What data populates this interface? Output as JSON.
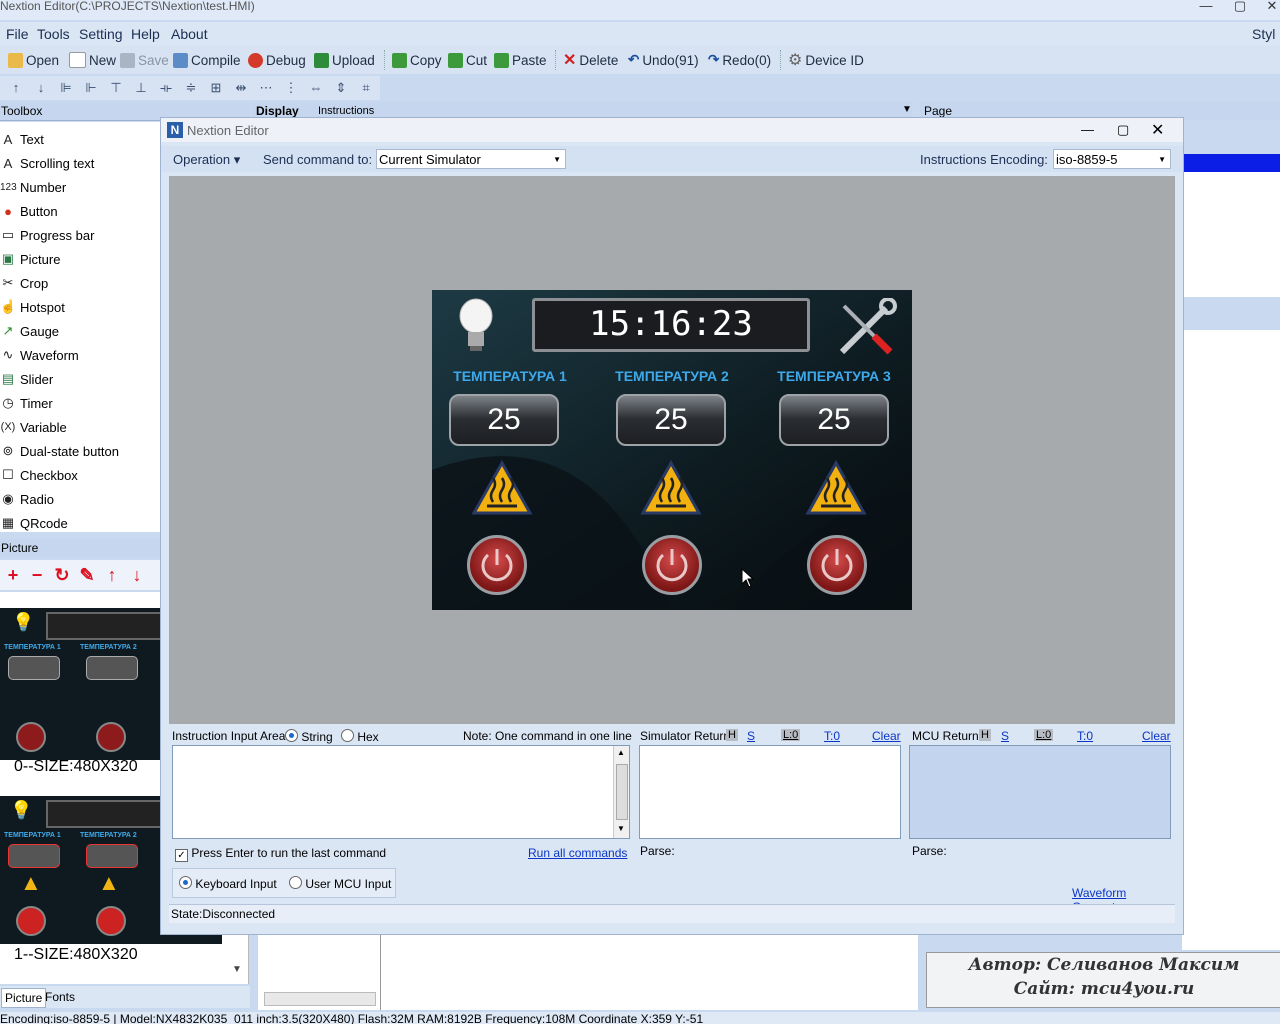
{
  "window": {
    "title": "Nextion Editor(C:\\PROJECTS\\Nextion\\test.HMI)",
    "corner_text": "Styl"
  },
  "menu": [
    "File",
    "Tools",
    "Setting",
    "Help",
    "About"
  ],
  "toolbar": {
    "open": "Open",
    "new": "New",
    "save": "Save",
    "compile": "Compile",
    "debug": "Debug",
    "upload": "Upload",
    "copy": "Copy",
    "cut": "Cut",
    "paste": "Paste",
    "delete": "Delete",
    "undo": "Undo(91)",
    "redo": "Redo(0)",
    "device": "Device  ID"
  },
  "toolbox": {
    "title": "Toolbox",
    "items": [
      "Text",
      "Scrolling text",
      "Number",
      "Button",
      "Progress bar",
      "Picture",
      "Crop",
      "Hotspot",
      "Gauge",
      "Waveform",
      "Slider",
      "Timer",
      "Variable",
      "Dual-state button",
      "Checkbox",
      "Radio",
      "QRcode"
    ],
    "glyphs": [
      "A",
      "A",
      "123",
      "●",
      "▭",
      "▣",
      "✂",
      "☝",
      "↗",
      "∿",
      "▤",
      "◷",
      "(X)",
      "⊚",
      "☐",
      "◉",
      "▦"
    ]
  },
  "picture_panel": {
    "title": "Picture",
    "thumb1_label": "0--SIZE:480X320",
    "thumb2_label": "1--SIZE:480X320",
    "thumb_temps": [
      "ТЕМПЕРАТУРА 1",
      "ТЕМПЕРАТУРА 2"
    ]
  },
  "bottom_tabs": [
    "Picture",
    "Fonts"
  ],
  "background": {
    "display_tab": "Display",
    "instructions_tab": "Instructions",
    "page_header": "Page"
  },
  "credit": {
    "line1": "Автор: Селиванов Максим",
    "line2": "Сайт: mcu4you.ru"
  },
  "status_bar": "Encoding:iso-8859-5 | Model:NX4832K035_011  inch:3.5(320X480) Flash:32M RAM:8192B Frequency:108M     Coordinate X:359  Y:-51",
  "dialog": {
    "title": "Nextion Editor",
    "operation": "Operation",
    "send_label": "Send command to:",
    "send_target": "Current Simulator",
    "encoding_label": "Instructions Encoding:",
    "encoding_value": "iso-8859-5",
    "screen": {
      "time": "15:16:23",
      "temps": [
        {
          "label": "ТЕМПЕРАТУРА 1",
          "value": "25"
        },
        {
          "label": "ТЕМПЕРАТУРА 2",
          "value": "25"
        },
        {
          "label": "ТЕМПЕРАТУРА 3",
          "value": "25"
        }
      ]
    },
    "input_area_label": "Instruction Input Area:",
    "mode_string": "String",
    "mode_hex": "Hex",
    "note": "Note: One command in one line",
    "sim_return": "Simulator Return:",
    "mcu_return": "MCU Return:",
    "flags": {
      "h": "H",
      "s": "S",
      "l": "L:0",
      "t": "T:0"
    },
    "clear": "Clear",
    "press_enter": "Press Enter to run the last command",
    "run_all": "Run all commands",
    "parse": "Parse:",
    "keyboard_input": "Keyboard Input",
    "user_mcu_input": "User MCU Input",
    "waveform_generator": "Waveform Generator",
    "state": "State:Disconnected"
  }
}
